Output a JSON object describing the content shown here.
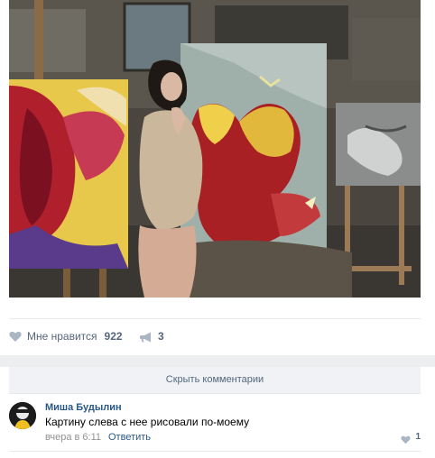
{
  "post": {
    "likes": {
      "label": "Мне нравится",
      "count": "922",
      "icon": "heart-icon"
    },
    "shares": {
      "count": "3",
      "icon": "megaphone-icon"
    }
  },
  "comments": {
    "hide_label": "Скрыть комментарии",
    "items": [
      {
        "author": "Миша Будылин",
        "text": "Картину слева с нее рисовали по-моему",
        "date": "вчера в 6:11",
        "reply_label": "Ответить",
        "like_count": "1"
      }
    ]
  },
  "colors": {
    "link": "#2a5885",
    "muted": "#55677d",
    "band": "#edeef0",
    "hide_bg": "#f0f2f5"
  }
}
